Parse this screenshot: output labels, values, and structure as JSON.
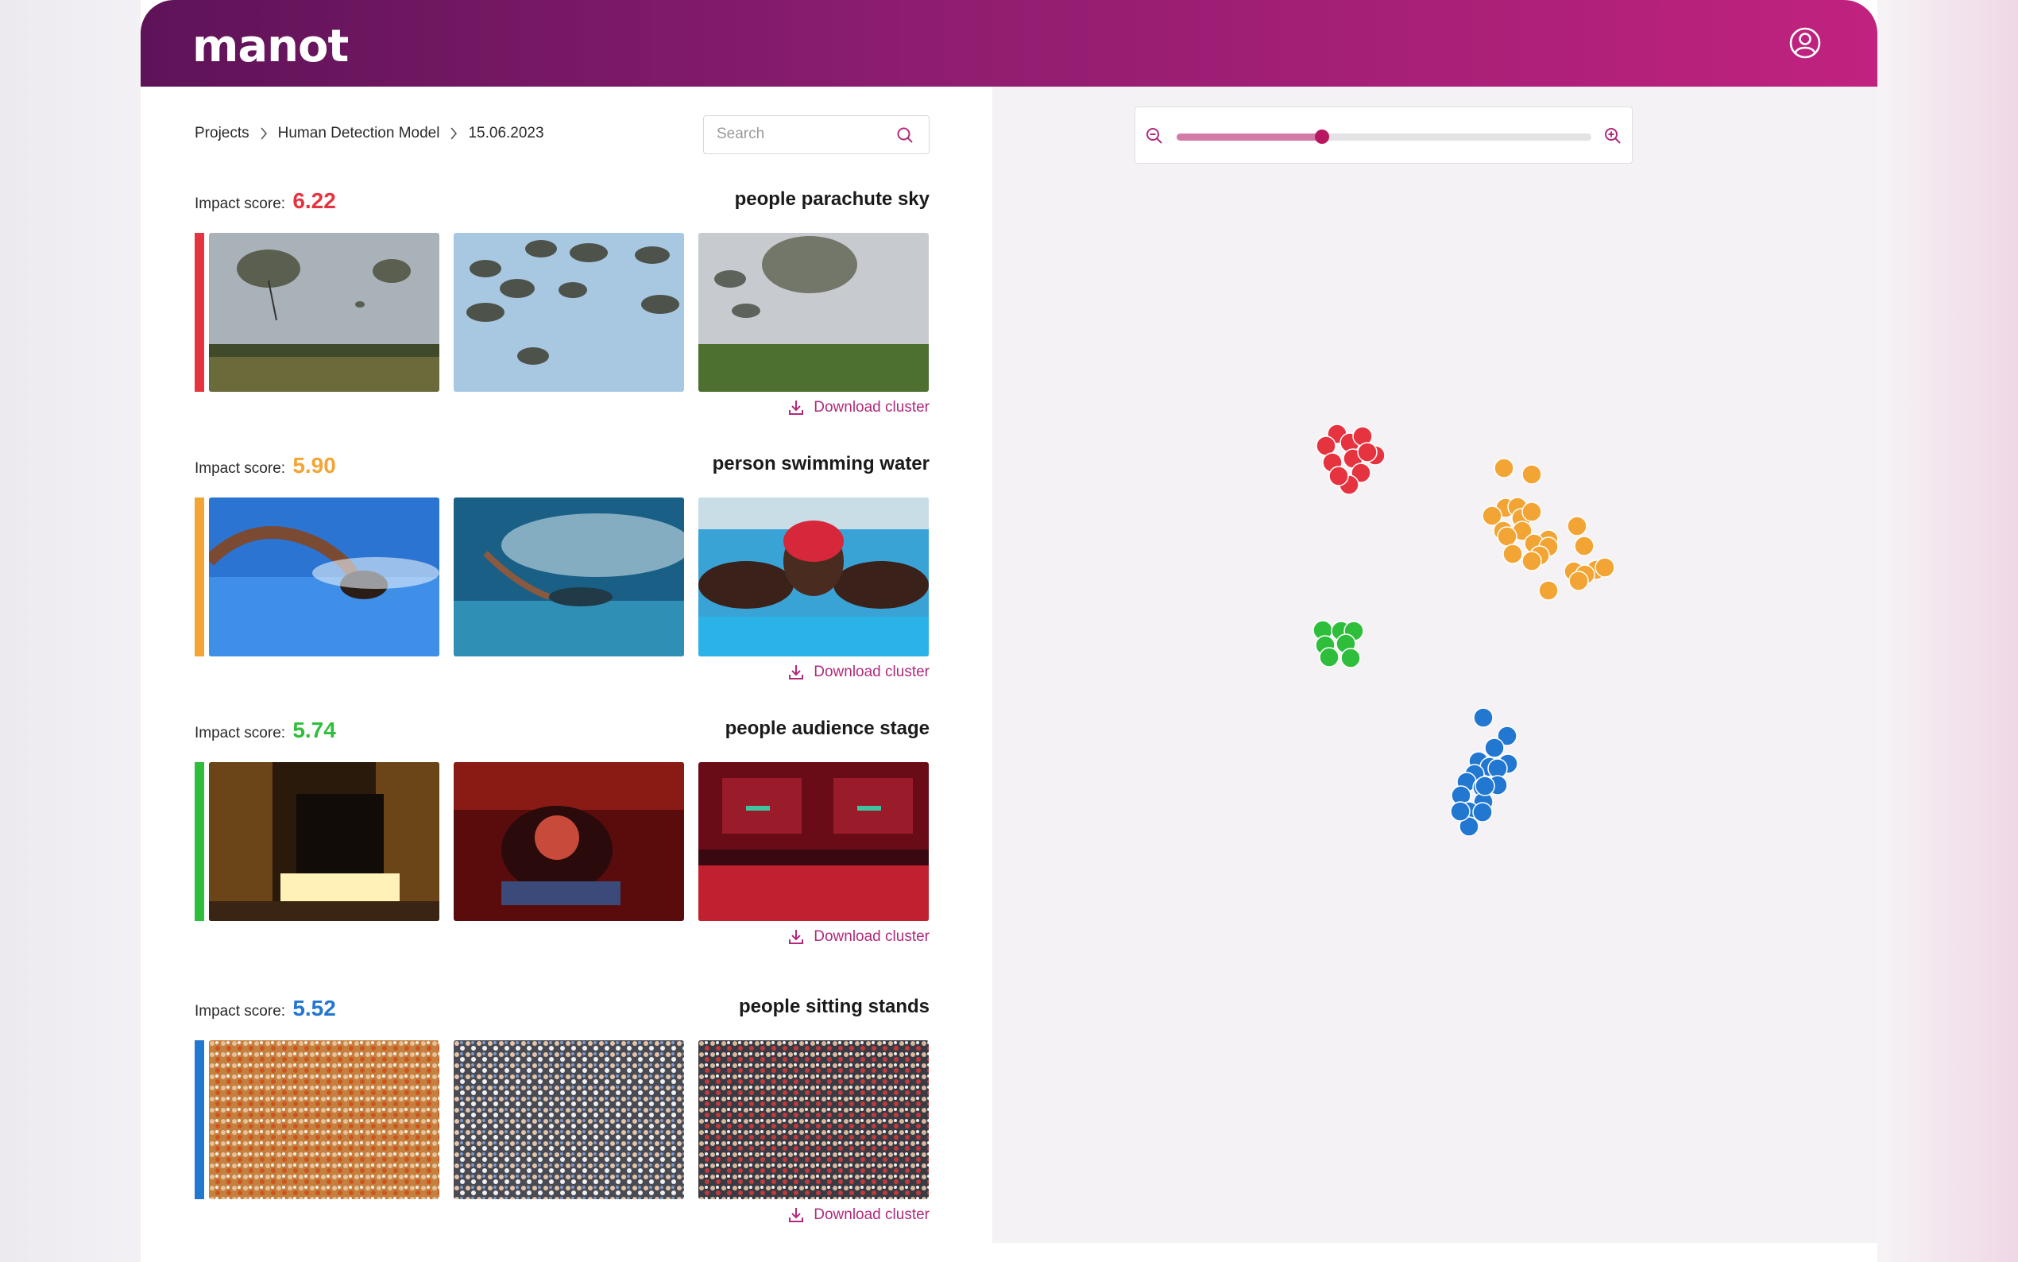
{
  "app": {
    "logo": "manot"
  },
  "breadcrumb": {
    "items": [
      "Projects",
      "Human Detection Model",
      "15.06.2023"
    ]
  },
  "search": {
    "placeholder": "Search"
  },
  "impact_label": "Impact score:",
  "download_label": "Download cluster",
  "clusters": [
    {
      "score": "6.22",
      "title": "people parachute sky",
      "color": "#e63340"
    },
    {
      "score": "5.90",
      "title": "person swimming water",
      "color": "#f2a534"
    },
    {
      "score": "5.74",
      "title": "people audience stage",
      "color": "#2fbe3c"
    },
    {
      "score": "5.52",
      "title": "people sitting stands",
      "color": "#2277d1"
    }
  ],
  "zoom": {
    "level": 0.35
  }
}
